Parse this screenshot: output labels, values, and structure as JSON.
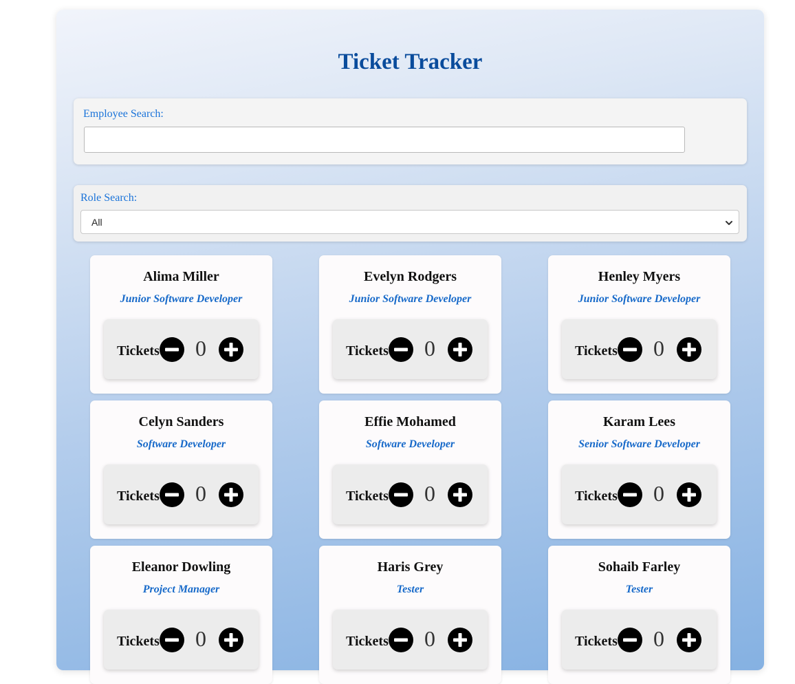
{
  "app": {
    "title": "Ticket Tracker"
  },
  "employee_search": {
    "label": "Employee Search:",
    "value": "",
    "placeholder": ""
  },
  "role_search": {
    "label": "Role Search:",
    "selected": "All"
  },
  "counter_label": "Tickets",
  "employees": [
    {
      "name": "Alima Miller",
      "role": "Junior Software Developer",
      "tickets": "0"
    },
    {
      "name": "Evelyn Rodgers",
      "role": "Junior Software Developer",
      "tickets": "0"
    },
    {
      "name": "Henley Myers",
      "role": "Junior Software Developer",
      "tickets": "0"
    },
    {
      "name": "Celyn Sanders",
      "role": "Software Developer",
      "tickets": "0"
    },
    {
      "name": "Effie Mohamed",
      "role": "Software Developer",
      "tickets": "0"
    },
    {
      "name": "Karam Lees",
      "role": "Senior Software Developer",
      "tickets": "0"
    },
    {
      "name": "Eleanor Dowling",
      "role": "Project Manager",
      "tickets": "0"
    },
    {
      "name": "Haris Grey",
      "role": "Tester",
      "tickets": "0"
    },
    {
      "name": "Sohaib Farley",
      "role": "Tester",
      "tickets": "0"
    }
  ],
  "icons": {
    "decrement": "minus-circle-icon",
    "increment": "plus-circle-icon",
    "select": "chevron-down-icon"
  },
  "colors": {
    "title": "#0a4c9c",
    "label": "#1a73d9",
    "role": "#1669c9"
  }
}
